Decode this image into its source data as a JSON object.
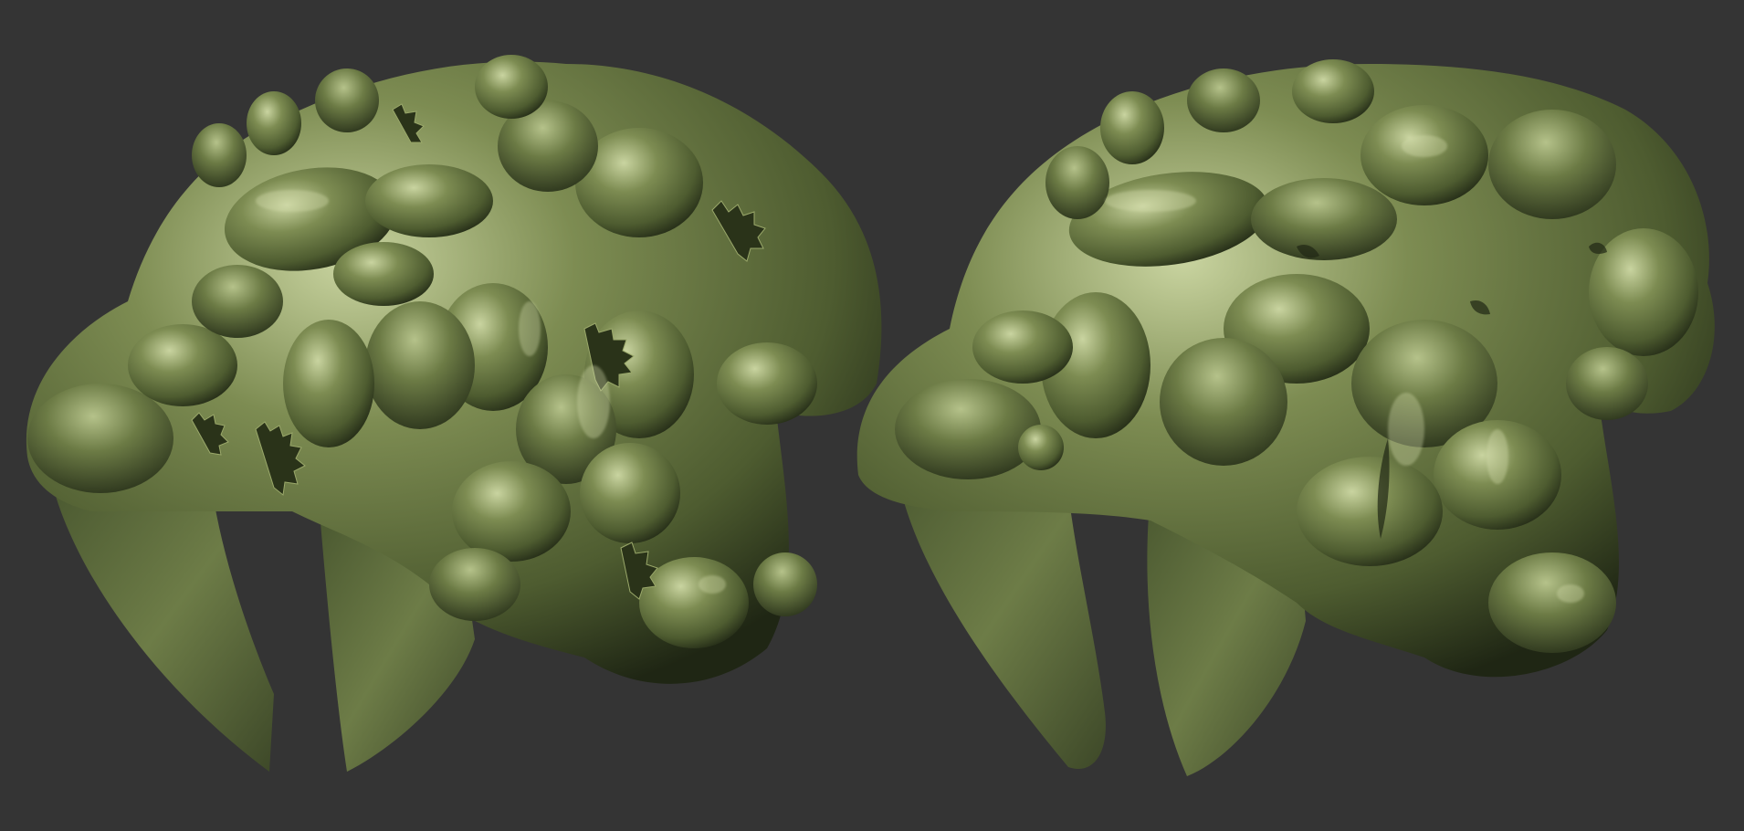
{
  "scene": {
    "background_color": "#343434",
    "object_base_color": "#5a6a3a",
    "object_highlight_color": "#c9d4a0",
    "object_shadow_color": "#1f2614",
    "models": [
      {
        "id": "left-model",
        "description_visible": "faceted-reconstruction"
      },
      {
        "id": "right-model",
        "description_visible": "smooth-reconstruction"
      }
    ]
  }
}
